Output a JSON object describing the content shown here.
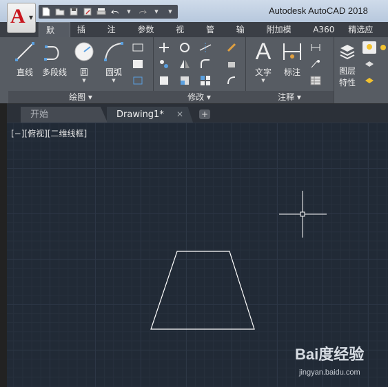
{
  "window": {
    "title": "Autodesk AutoCAD 2018"
  },
  "app_button": {
    "letter": "A"
  },
  "ribbon": {
    "tabs": [
      "默认",
      "插入",
      "注释",
      "参数化",
      "视图",
      "管理",
      "输出",
      "附加模块",
      "A360",
      "精选应用"
    ],
    "active_tab": "默认",
    "panels": {
      "draw": {
        "title": "绘图 ▾",
        "tools": [
          "直线",
          "多段线",
          "圆",
          "圆弧"
        ]
      },
      "modify": {
        "title": "修改 ▾"
      },
      "annotation": {
        "title": "注释 ▾",
        "tools": [
          "文字",
          "标注"
        ]
      },
      "layers": {
        "tools_line1": "图层",
        "tools_line2": "特性"
      }
    }
  },
  "document_tabs": [
    {
      "label": "开始",
      "active": false
    },
    {
      "label": "Drawing1*",
      "active": true,
      "close": "✕"
    }
  ],
  "new_tab": "+",
  "viewport_label": "[−][俯视][二维线框]",
  "drawing": {
    "shape": "trapezoid",
    "stroke": "#ffffff"
  },
  "colors": {
    "canvas": "#212a36",
    "ribbon": "#575c63",
    "accent_red": "#c8161e"
  },
  "watermark": {
    "logo": "Bai度经验",
    "url": "jingyan.baidu.com"
  }
}
